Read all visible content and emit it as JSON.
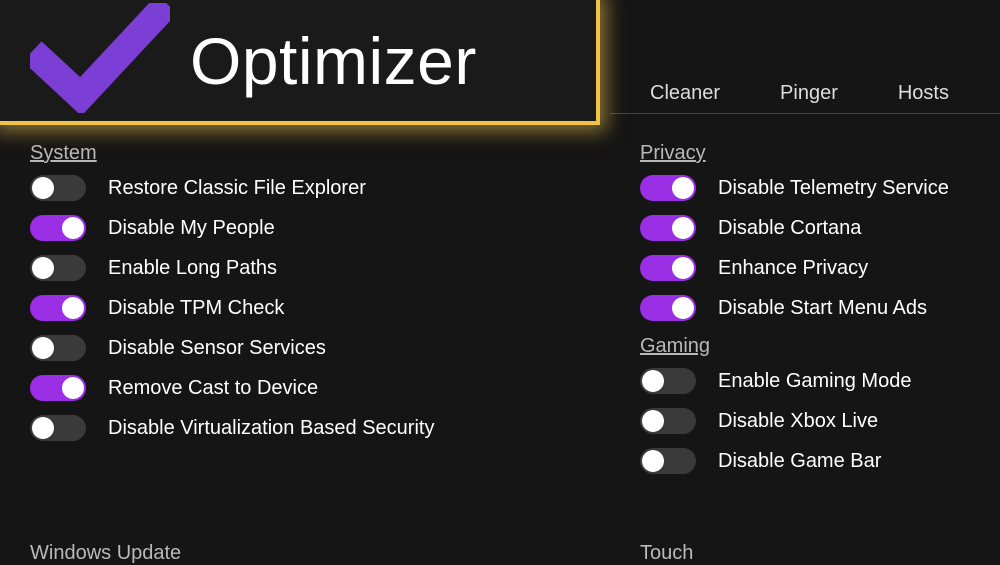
{
  "app_title": "Optimizer",
  "tabs": [
    "Cleaner",
    "Pinger",
    "Hosts"
  ],
  "colors": {
    "accent": "#9b2fe6",
    "banner_glow": "#f0c24a"
  },
  "left": {
    "section1_title": "System",
    "section1_items": [
      {
        "label": "Restore Classic File Explorer",
        "on": false
      },
      {
        "label": "Disable My People",
        "on": true
      },
      {
        "label": "Enable Long Paths",
        "on": false
      },
      {
        "label": "Disable TPM Check",
        "on": true
      },
      {
        "label": "Disable Sensor Services",
        "on": false
      },
      {
        "label": "Remove Cast to Device",
        "on": true
      },
      {
        "label": "Disable Virtualization Based Security",
        "on": false
      }
    ],
    "section2_title": "Windows Update"
  },
  "right": {
    "section1_title": "Privacy",
    "section1_items": [
      {
        "label": "Disable Telemetry Service",
        "on": true
      },
      {
        "label": "Disable Cortana",
        "on": true
      },
      {
        "label": "Enhance Privacy",
        "on": true
      },
      {
        "label": "Disable Start Menu Ads",
        "on": true
      }
    ],
    "section2_title": "Gaming",
    "section2_items": [
      {
        "label": "Enable Gaming Mode",
        "on": false
      },
      {
        "label": "Disable Xbox Live",
        "on": false
      },
      {
        "label": "Disable Game Bar",
        "on": false
      }
    ],
    "section3_title": "Touch"
  }
}
